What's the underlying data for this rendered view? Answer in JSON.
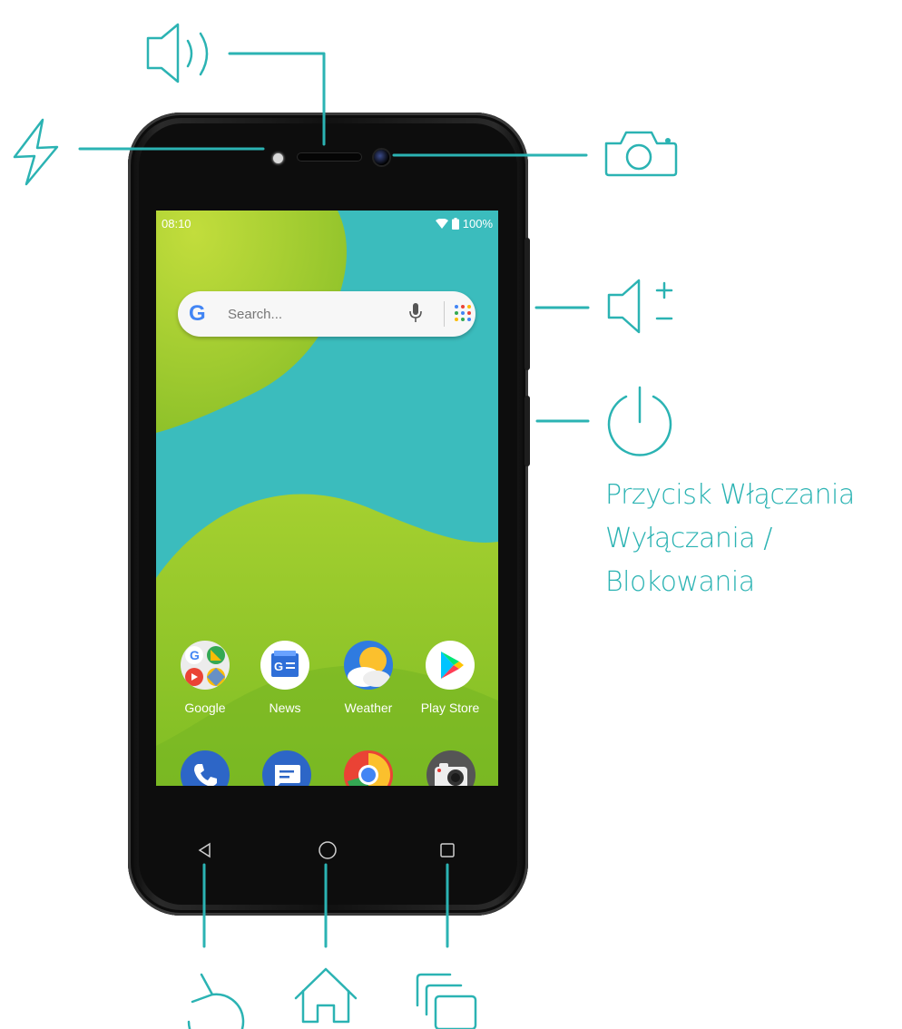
{
  "colors": {
    "accent": "#2bb3b3",
    "phone_body": "#111111",
    "wallpaper_teal": "#3bbcbd",
    "wallpaper_green": "#9ccc28"
  },
  "status_bar": {
    "time": "08:10",
    "battery": "100%"
  },
  "search": {
    "logo": "G",
    "placeholder": "Search..."
  },
  "apps": [
    {
      "label": "Google",
      "icon": "google-folder-icon"
    },
    {
      "label": "News",
      "icon": "news-icon"
    },
    {
      "label": "Weather",
      "icon": "weather-icon"
    },
    {
      "label": "Play Store",
      "icon": "play-store-icon"
    }
  ],
  "dock": [
    {
      "icon": "phone-icon"
    },
    {
      "icon": "messages-icon"
    },
    {
      "icon": "chrome-icon"
    },
    {
      "icon": "camera-app-icon"
    }
  ],
  "callouts": {
    "power_label": [
      "Przycisk Włączania",
      "Wyłączania /",
      "Blokowania"
    ]
  }
}
